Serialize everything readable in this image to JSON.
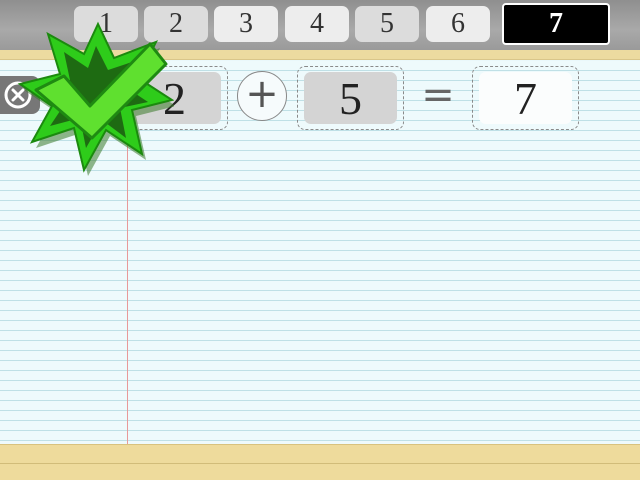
{
  "number_tiles": [
    {
      "label": "1"
    },
    {
      "label": "2"
    },
    {
      "label": "3"
    },
    {
      "label": "4"
    },
    {
      "label": "5"
    },
    {
      "label": "6"
    },
    {
      "label": "7",
      "selected": true
    }
  ],
  "equation": {
    "first_operand": "2",
    "operator": "+",
    "second_operand": "5",
    "equals_sign": "=",
    "answer": "7"
  },
  "icons": {
    "close": "close-icon",
    "success": "checkmark-badge-icon"
  },
  "colors": {
    "selected_tile": "#000000",
    "badge_green": "#2ecc1a",
    "margin_line": "#e89a9a",
    "paper_line": "#bfe0e6"
  }
}
